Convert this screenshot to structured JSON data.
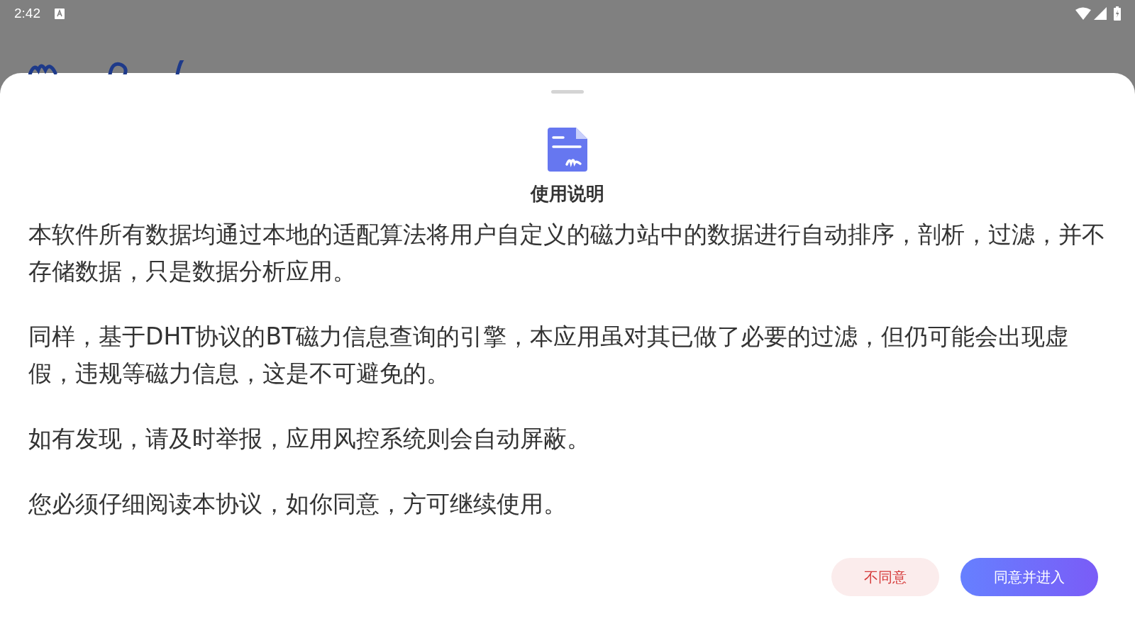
{
  "status_bar": {
    "time": "2:42"
  },
  "dialog": {
    "title": "使用说明",
    "paragraphs": [
      "本软件所有数据均通过本地的适配算法将用户自定义的磁力站中的数据进行自动排序，剖析，过滤，并不存储数据，只是数据分析应用。",
      "同样，基于DHT协议的BT磁力信息查询的引擎，本应用虽对其已做了必要的过滤，但仍可能会出现虚假，违规等磁力信息，这是不可避免的。",
      "如有发现，请及时举报，应用风控系统则会自动屏蔽。",
      "您必须仔细阅读本协议，如你同意，方可继续使用。"
    ],
    "buttons": [
      {
        "label": "不同意",
        "kind": "decline"
      },
      {
        "label": "同意并进入",
        "kind": "accept"
      }
    ]
  }
}
